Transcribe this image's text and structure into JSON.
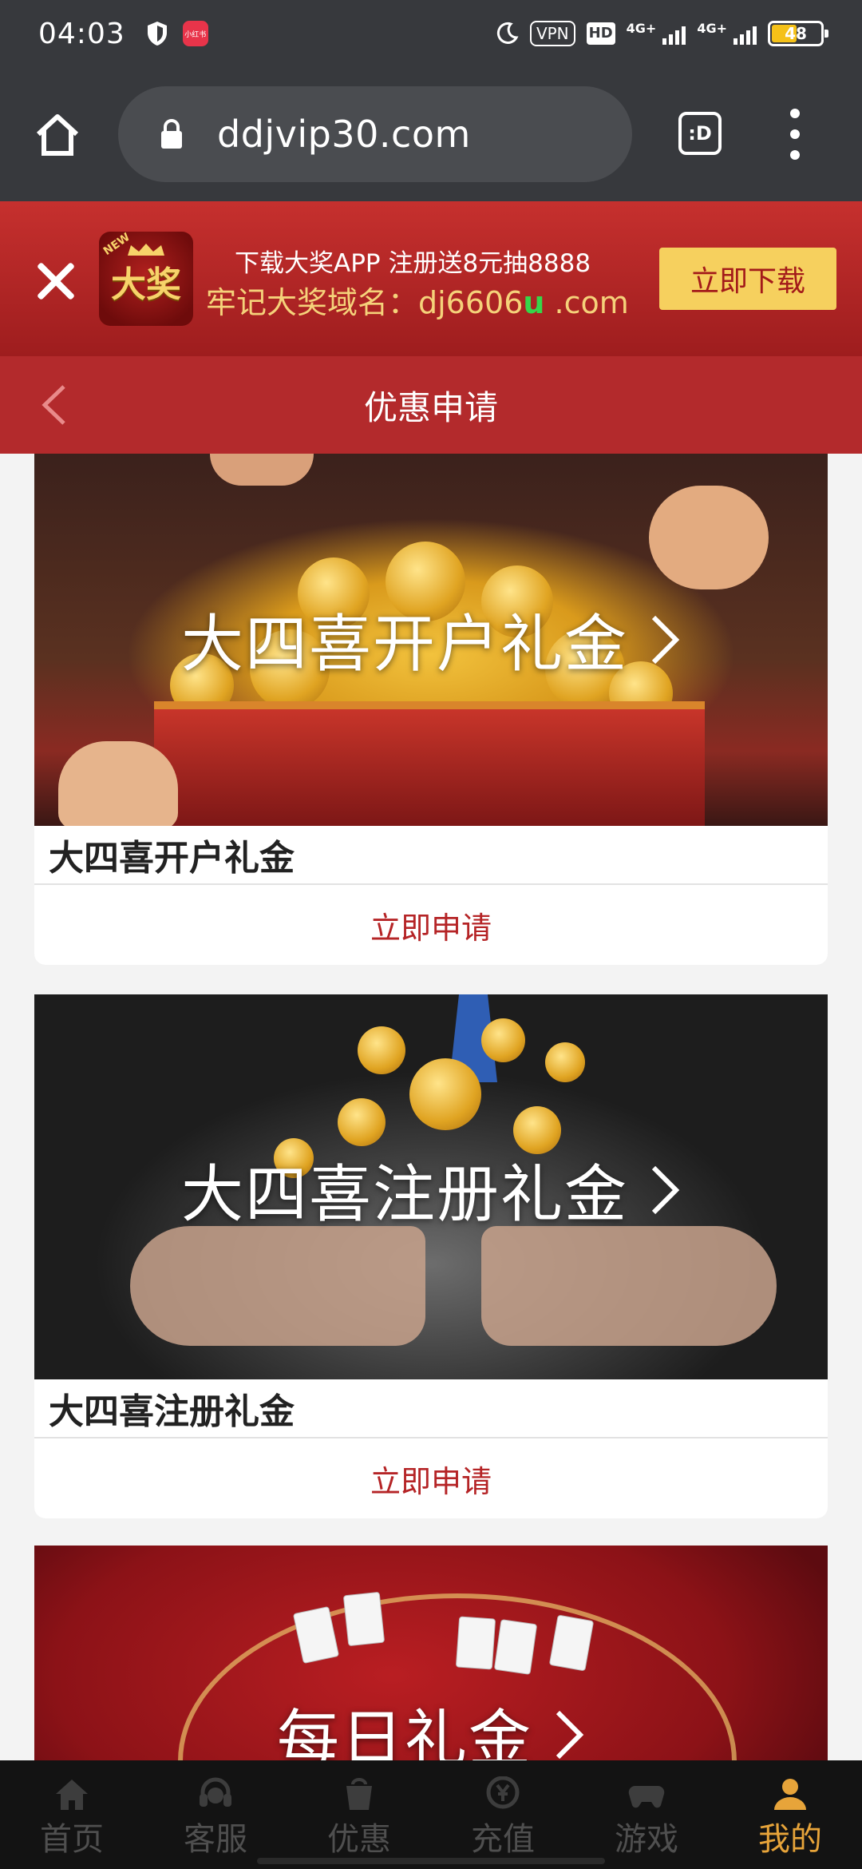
{
  "status_bar": {
    "time": "04:03",
    "app_badge": "小红书",
    "vpn": "VPN",
    "hd": "HD",
    "net1": "4G+",
    "net2": "4G+",
    "battery": "48",
    "battery_fraction": 0.48
  },
  "browser": {
    "url": "ddjvip30.com",
    "tabs_label": ":D"
  },
  "download_banner": {
    "line1": "下载大奖APP 注册送8元抽8888",
    "line2_prefix": "牢记大奖域名：dj6606",
    "line2_highlight": "u",
    "line2_suffix": " .com",
    "logo_text": "大奖",
    "logo_new": "NEW",
    "button_label": "立即下载",
    "colors": {
      "banner": "#b8292a",
      "button": "#f6d05e",
      "domain_highlight": "#35d64a"
    }
  },
  "header": {
    "title": "优惠申请"
  },
  "promotions": [
    {
      "image_text": "大四喜开户礼金",
      "name": "大四喜开户礼金",
      "apply_label": "立即申请"
    },
    {
      "image_text": "大四喜注册礼金",
      "name": "大四喜注册礼金",
      "apply_label": "立即申请"
    },
    {
      "image_text": "每日礼金"
    }
  ],
  "bottom_nav": {
    "items": [
      {
        "label": "首页",
        "icon": "home-icon"
      },
      {
        "label": "客服",
        "icon": "headset-icon"
      },
      {
        "label": "优惠",
        "icon": "gift-bag-icon"
      },
      {
        "label": "充值",
        "icon": "yen-coin-icon"
      },
      {
        "label": "游戏",
        "icon": "gamepad-icon"
      },
      {
        "label": "我的",
        "icon": "user-icon",
        "active": true
      }
    ],
    "active_color": "#e7a43a"
  }
}
